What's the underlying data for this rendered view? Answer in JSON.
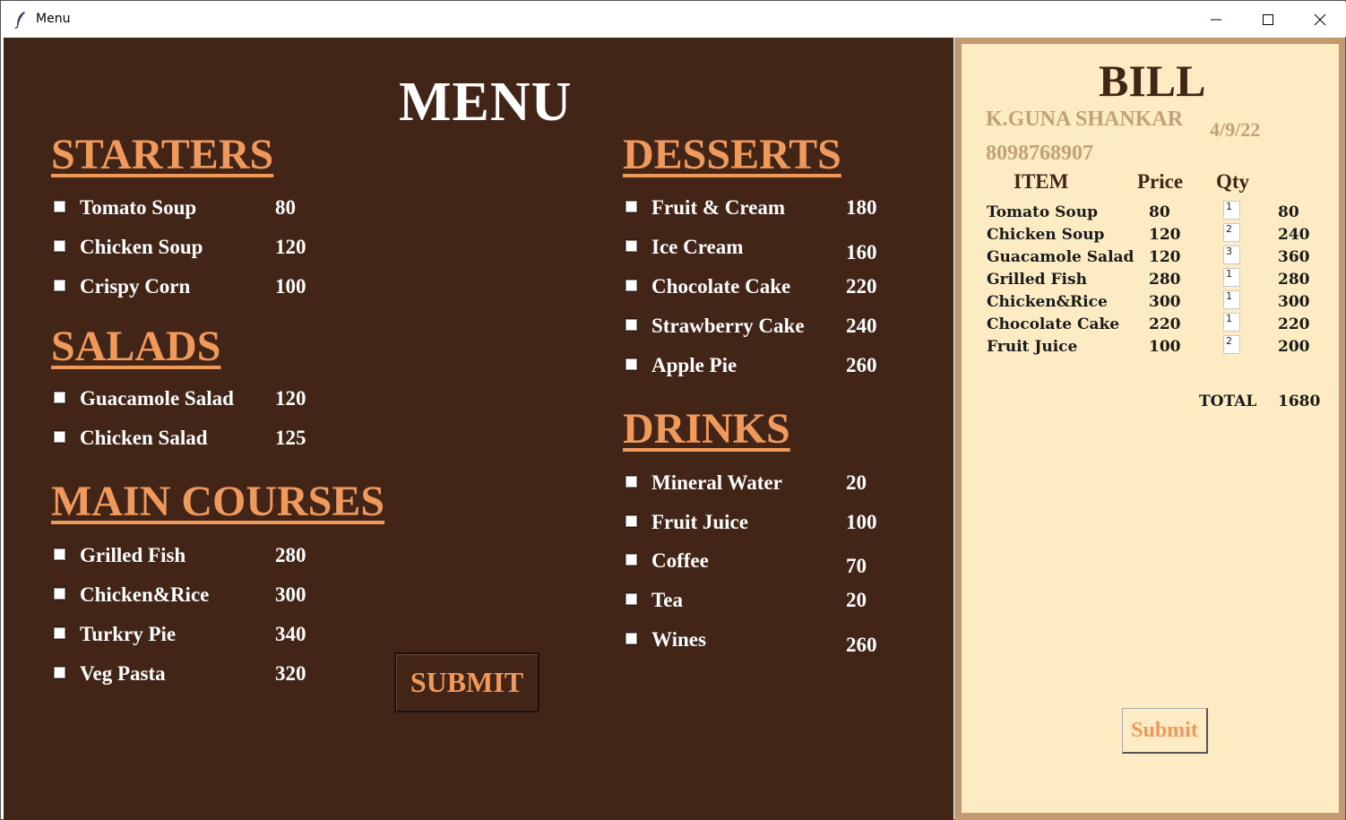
{
  "window": {
    "title": "Menu",
    "app_icon": "feather-icon"
  },
  "menu": {
    "title": "MENU",
    "starters": {
      "title": "STARTERS",
      "items": [
        {
          "name": "Tomato Soup",
          "price": "80"
        },
        {
          "name": "Chicken Soup",
          "price": "120"
        },
        {
          "name": "Crispy Corn",
          "price": "100"
        }
      ]
    },
    "salads": {
      "title": "SALADS",
      "items": [
        {
          "name": "Guacamole Salad",
          "price": "120"
        },
        {
          "name": "Chicken Salad",
          "price": "125"
        }
      ]
    },
    "main_courses": {
      "title": "MAIN COURSES",
      "items": [
        {
          "name": "Grilled Fish",
          "price": "280"
        },
        {
          "name": "Chicken&Rice",
          "price": "300"
        },
        {
          "name": "Turkry Pie",
          "price": "340"
        },
        {
          "name": "Veg Pasta",
          "price": "320"
        }
      ]
    },
    "desserts": {
      "title": "DESSERTS",
      "items": [
        {
          "name": "Fruit & Cream",
          "price": "180"
        },
        {
          "name": "Ice Cream",
          "price": "160"
        },
        {
          "name": "Chocolate Cake",
          "price": "220"
        },
        {
          "name": "Strawberry Cake",
          "price": "240"
        },
        {
          "name": "Apple Pie",
          "price": "260"
        }
      ]
    },
    "drinks": {
      "title": "DRINKS",
      "items": [
        {
          "name": "Mineral Water",
          "price": "20"
        },
        {
          "name": "Fruit Juice",
          "price": "100"
        },
        {
          "name": "Coffee",
          "price": "70"
        },
        {
          "name": "Tea",
          "price": "20"
        },
        {
          "name": "Wines",
          "price": "260"
        }
      ]
    },
    "submit_label": "SUBMIT"
  },
  "bill": {
    "title": "BILL",
    "customer_name": "K.GUNA SHANKAR",
    "date": "4/9/22",
    "phone": "8098768907",
    "headers": {
      "item": "ITEM",
      "price": "Price",
      "qty": "Qty"
    },
    "rows": [
      {
        "item": "Tomato Soup",
        "price": "80",
        "qty": "1",
        "amount": "80"
      },
      {
        "item": "Chicken Soup",
        "price": "120",
        "qty": "2",
        "amount": "240"
      },
      {
        "item": "Guacamole Salad",
        "price": "120",
        "qty": "3",
        "amount": "360"
      },
      {
        "item": "Grilled Fish",
        "price": "280",
        "qty": "1",
        "amount": "280"
      },
      {
        "item": "Chicken&Rice",
        "price": "300",
        "qty": "1",
        "amount": "300"
      },
      {
        "item": "Chocolate Cake",
        "price": "220",
        "qty": "1",
        "amount": "220"
      },
      {
        "item": "Fruit Juice",
        "price": "100",
        "qty": "2",
        "amount": "200"
      }
    ],
    "total_label": "TOTAL",
    "total_value": "1680",
    "submit_label": "Submit"
  },
  "colors": {
    "menu_bg": "#432518",
    "accent": "#ef9a5c",
    "bill_bg": "#fdecc3",
    "bill_border": "#c29a71",
    "customer_text": "#c2a07b"
  }
}
